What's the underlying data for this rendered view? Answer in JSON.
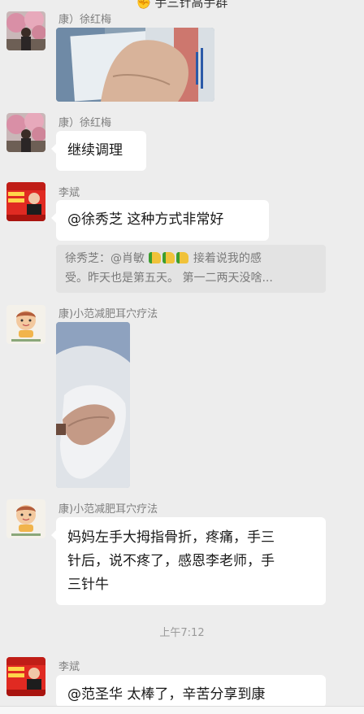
{
  "chat": {
    "title": "手三针高手群"
  },
  "messages": [
    {
      "sender": "康）徐红梅",
      "type": "image"
    },
    {
      "sender": "康）徐红梅",
      "text": "继续调理"
    },
    {
      "sender": "李斌",
      "text": "@徐秀芝  这种方式非常好",
      "quote_line1_pre": "徐秀芝：@肖敏 ",
      "quote_line1_post": " 接着说我的感",
      "quote_line2": "受。昨天也是第五天。 第一二两天没啥..."
    },
    {
      "sender": "康)小范减肥耳穴疗法",
      "type": "image"
    },
    {
      "sender": "康)小范减肥耳穴疗法",
      "text_line1": "妈妈左手大拇指骨折，疼痛，手三",
      "text_line2": "针后，说不疼了，感恩李老师，手",
      "text_line3": "三针牛"
    },
    {
      "sender": "李斌",
      "text": "@范圣华  太棒了，辛苦分享到康"
    }
  ],
  "timestamp": "上午7:12",
  "colors": {
    "background": "#ededed",
    "bubble": "#ffffff",
    "quote": "#e3e3e3"
  }
}
